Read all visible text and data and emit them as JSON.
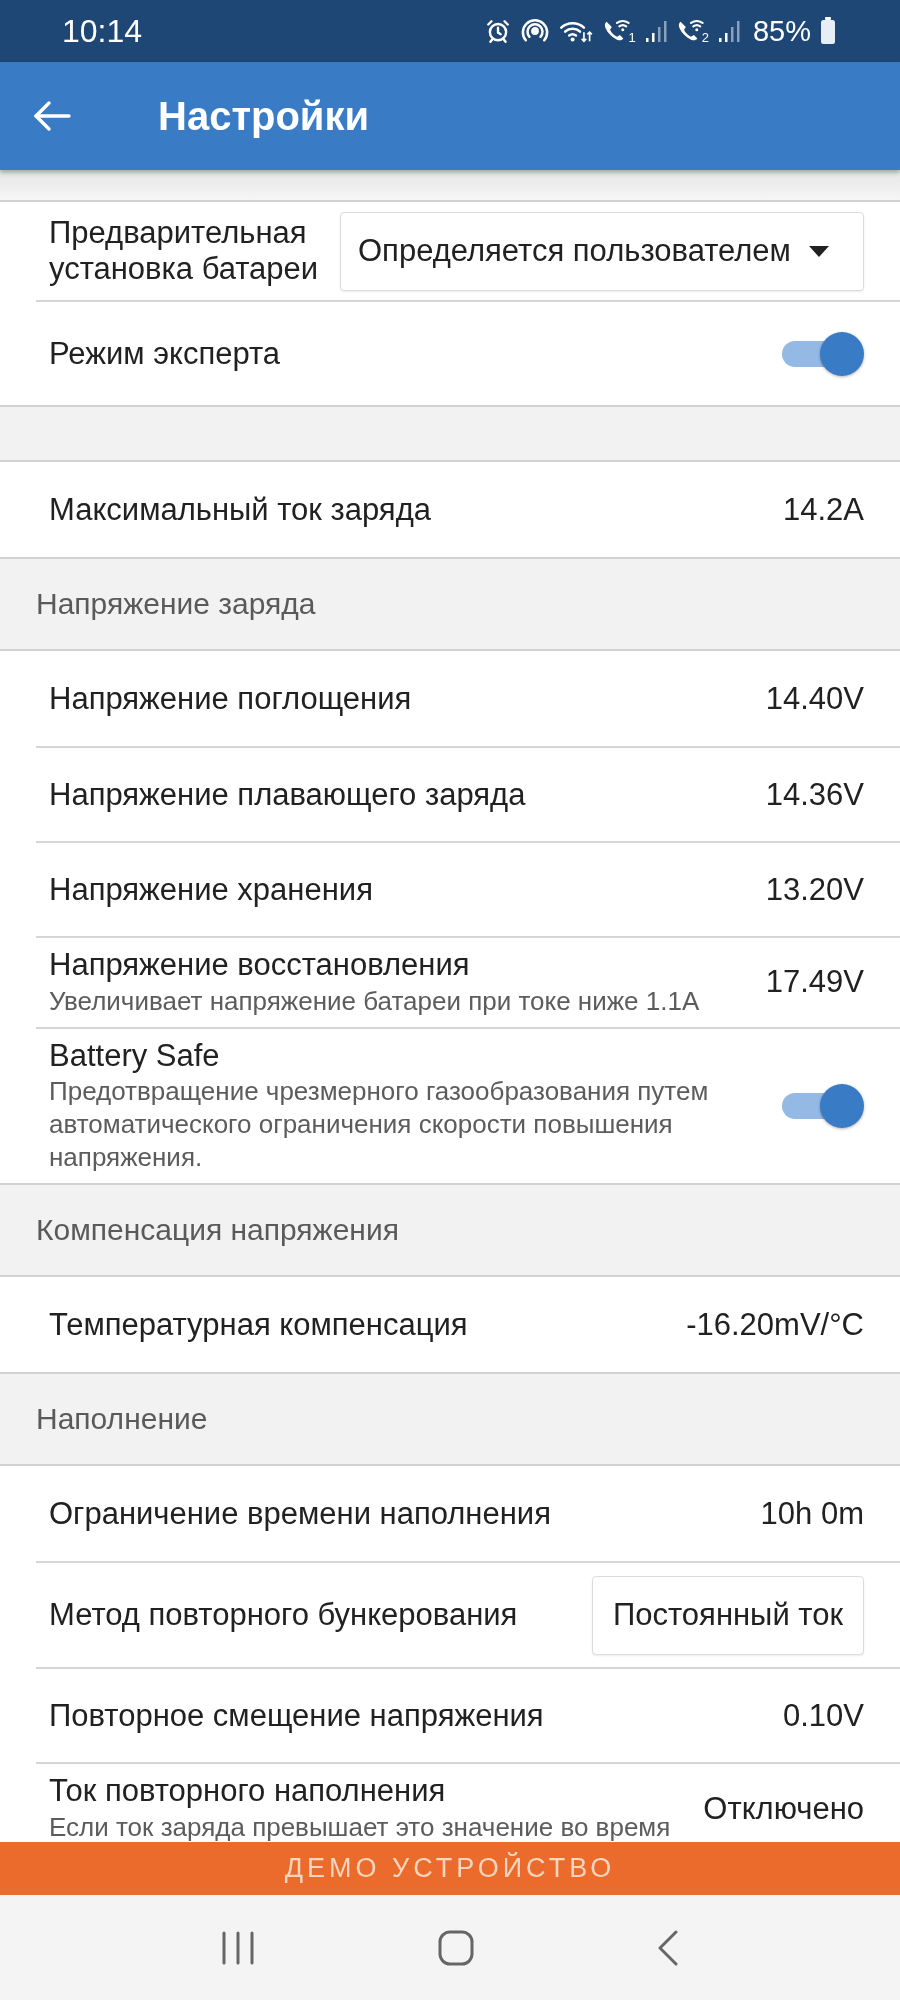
{
  "status_bar": {
    "time": "10:14",
    "sim_slots": [
      {
        "label": "1"
      },
      {
        "label": "2"
      }
    ],
    "battery": "85%"
  },
  "app_bar": {
    "title": "Настройки"
  },
  "groups": [
    {
      "rows": [
        {
          "kind": "dropdown",
          "label": "Предварительная установка батареи",
          "value": "Определяется пользователем"
        },
        {
          "kind": "toggle",
          "label": "Режим эксперта",
          "on": true
        }
      ]
    },
    {
      "rows": [
        {
          "kind": "value",
          "label": "Максимальный ток заряда",
          "value": "14.2A"
        }
      ]
    },
    {
      "title": "Напряжение заряда",
      "rows": [
        {
          "kind": "value",
          "label": "Напряжение поглощения",
          "value": "14.40V"
        },
        {
          "kind": "value",
          "label": "Напряжение плавающего заряда",
          "value": "14.36V"
        },
        {
          "kind": "value",
          "label": "Напряжение хранения",
          "value": "13.20V"
        },
        {
          "kind": "value",
          "label": "Напряжение восстановления",
          "description": "Увеличивает напряжение батареи при токе ниже 1.1A",
          "value": "17.49V"
        },
        {
          "kind": "toggle",
          "label": "Battery Safe",
          "description": "Предотвращение чрезмерного газообразования путем автоматического ограничения скорости повышения напряжения.",
          "on": true
        }
      ]
    },
    {
      "title": "Компенсация напряжения",
      "rows": [
        {
          "kind": "value",
          "label": "Температурная компенсация",
          "value": "-16.20mV/°C"
        }
      ]
    },
    {
      "title": "Наполнение",
      "rows": [
        {
          "kind": "value",
          "label": "Ограничение времени наполнения",
          "value": "10h 0m"
        },
        {
          "kind": "button",
          "label": "Метод повторного бункерования",
          "value": "Постоянный ток"
        },
        {
          "kind": "value",
          "label": "Повторное смещение напряжения",
          "value": "0.10V"
        },
        {
          "kind": "value",
          "label": "Ток повторного наполнения",
          "description": "Если ток заряда превышает это значение во время",
          "value": "Отключено"
        }
      ]
    }
  ],
  "demo_banner": "ДЕМО УСТРОЙСТВО"
}
